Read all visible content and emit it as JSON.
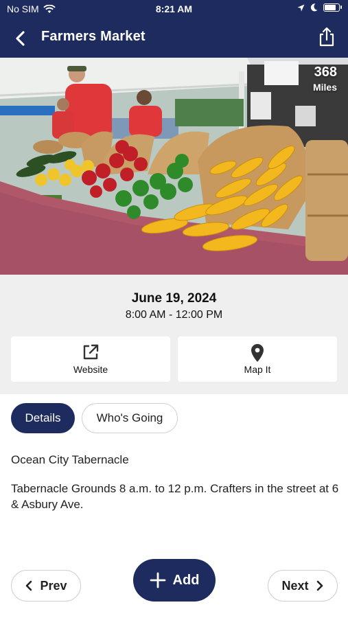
{
  "status_bar": {
    "carrier": "No SIM",
    "time": "8:21 AM",
    "battery_level": 0.85
  },
  "nav": {
    "title": "Farmers Market",
    "back_icon": "chevron-left-icon",
    "share_icon": "share-icon"
  },
  "event": {
    "distance_value": "368",
    "distance_unit": "Miles",
    "date": "June 19, 2024",
    "hours": "8:00 AM - 12:00 PM",
    "actions": [
      {
        "label": "Website",
        "icon": "external-link-icon"
      },
      {
        "label": "Map It",
        "icon": "map-pin-icon"
      }
    ]
  },
  "tabs": [
    {
      "label": "Details",
      "active": true
    },
    {
      "label": "Who's Going",
      "active": false
    }
  ],
  "details": {
    "venue": "Ocean City Tabernacle",
    "description": " Tabernacle Grounds 8 a.m. to 12 p.m. Crafters in the street at 6 & Asbury Ave."
  },
  "footer": {
    "prev_label": "Prev",
    "add_label": "Add",
    "next_label": "Next"
  },
  "colors": {
    "brand_navy": "#1d2b5e",
    "panel_gray": "#efefef"
  }
}
